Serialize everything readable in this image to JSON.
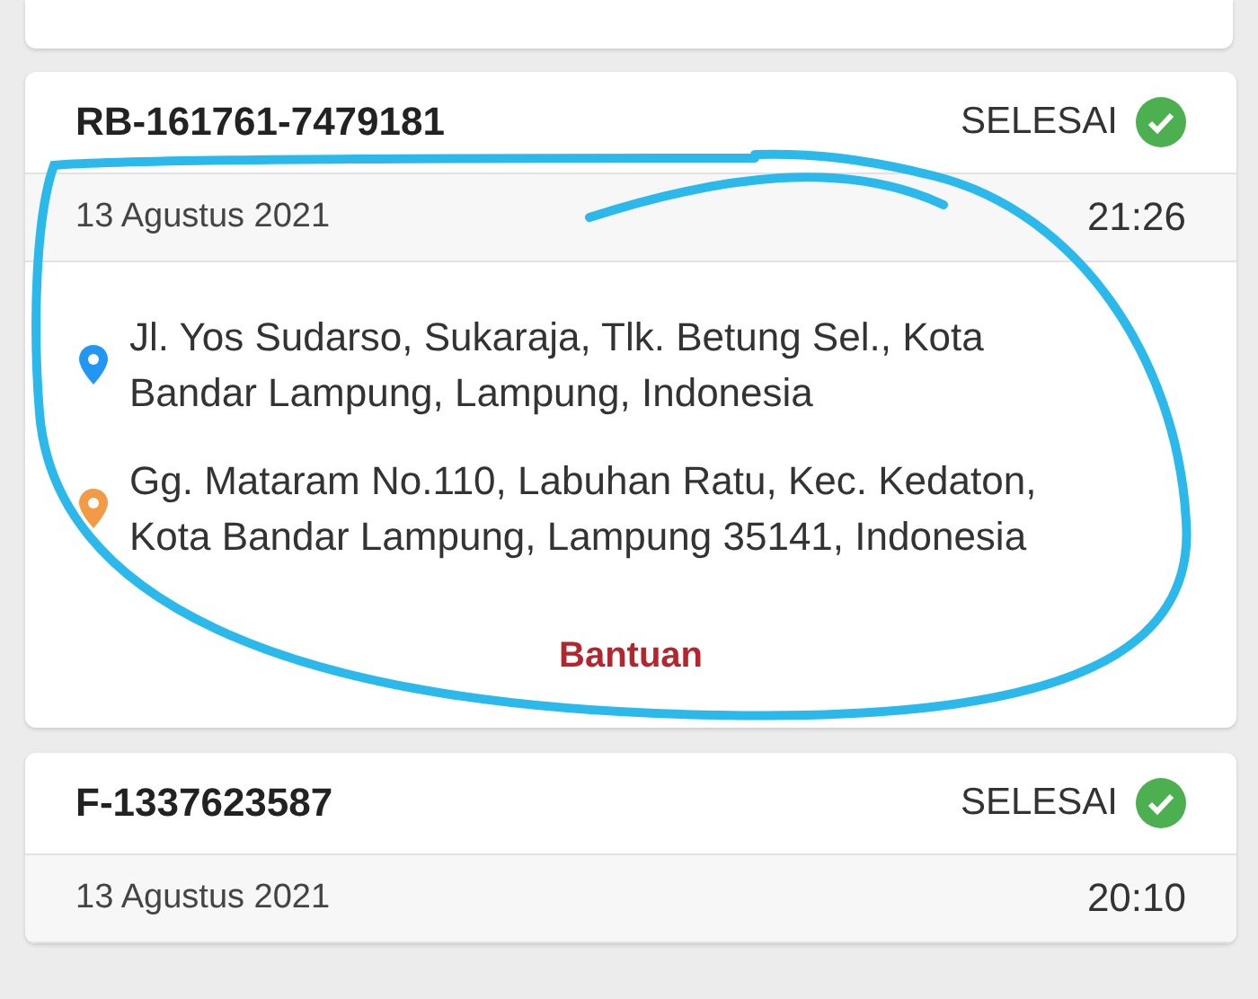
{
  "orders": [
    {
      "id": "RB-161761-7479181",
      "status": "SELESAI",
      "date": "13 Agustus 2021",
      "time": "21:26",
      "addresses": [
        {
          "kind": "pickup",
          "lines": [
            "Jl. Yos Sudarso, Sukaraja, Tlk. Betung Sel., Kota",
            "Bandar Lampung, Lampung, Indonesia"
          ]
        },
        {
          "kind": "dropoff",
          "lines": [
            "Gg. Mataram No.110, Labuhan Ratu, Kec. Kedaton,",
            "Kota Bandar Lampung, Lampung 35141, Indonesia"
          ]
        }
      ],
      "help_link": "Bantuan"
    },
    {
      "id": "F-1337623587",
      "status": "SELESAI",
      "date": "13 Agustus 2021",
      "time": "20:10"
    }
  ]
}
